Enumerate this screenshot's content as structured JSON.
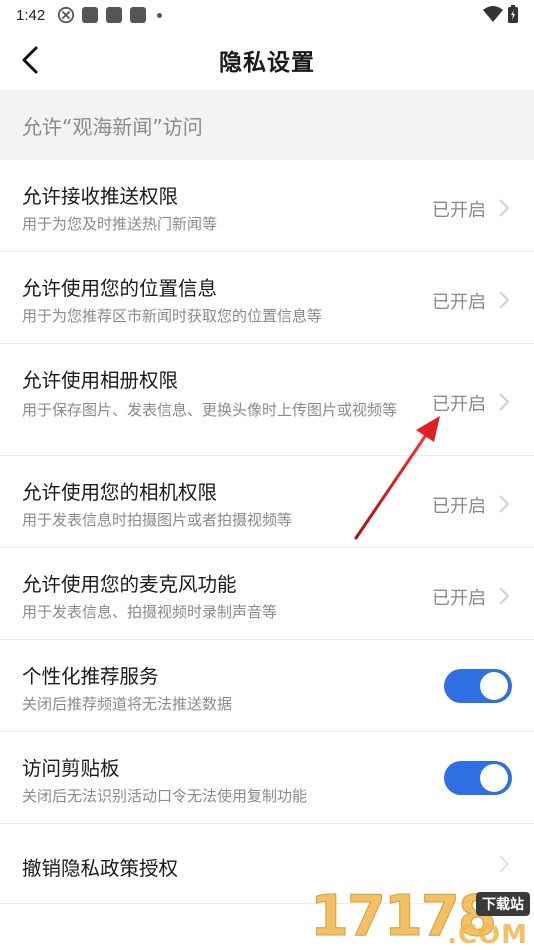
{
  "status_bar": {
    "time": "1:42"
  },
  "header": {
    "title": "隐私设置"
  },
  "section": {
    "label": "允许“观海新闻”访问"
  },
  "items": [
    {
      "title": "允许接收推送权限",
      "desc": "用于为您及时推送热门新闻等",
      "status": "已开启"
    },
    {
      "title": "允许使用您的位置信息",
      "desc": "用于为您推荐区市新闻时获取您的位置信息等",
      "status": "已开启"
    },
    {
      "title": "允许使用相册权限",
      "desc": "用于保存图片、发表信息、更换头像时上传图片或视频等",
      "status": "已开启"
    },
    {
      "title": "允许使用您的相机权限",
      "desc": "用于发表信息时拍摄图片或者拍摄视频等",
      "status": "已开启"
    },
    {
      "title": "允许使用您的麦克风功能",
      "desc": "用于发表信息、拍摄视频时录制声音等",
      "status": "已开启"
    }
  ],
  "toggles": [
    {
      "title": "个性化推荐服务",
      "desc": "关闭后推荐频道将无法推送数据",
      "on": true
    },
    {
      "title": "访问剪贴板",
      "desc": "关闭后无法识别活动口令无法使用复制功能",
      "on": true
    }
  ],
  "revoke": {
    "title": "撤销隐私政策授权"
  },
  "watermark": {
    "digits": "17178",
    "tag": "下载站",
    "suffix": ".COM"
  },
  "colors": {
    "accent": "#2f6fe4",
    "section_bg": "#f3f3f3",
    "annotation": "#e02020"
  }
}
